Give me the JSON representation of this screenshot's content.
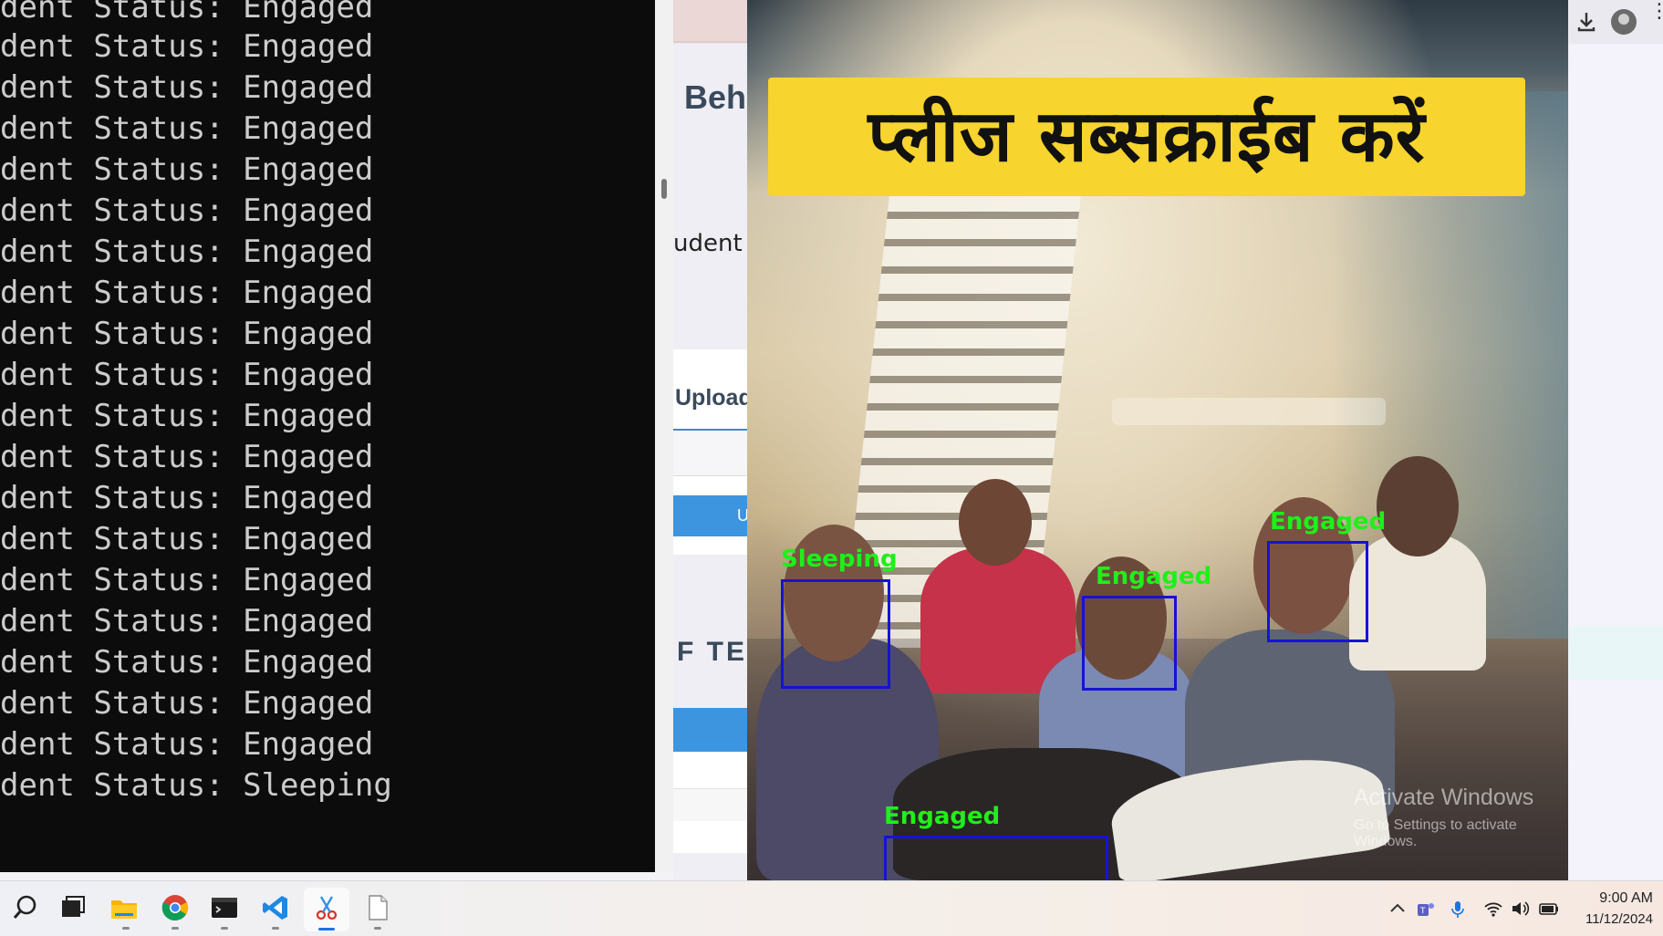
{
  "terminal": {
    "lines": [
      "dent Status: Engaged",
      "dent Status: Engaged",
      "dent Status: Engaged",
      "dent Status: Engaged",
      "dent Status: Engaged",
      "dent Status: Engaged",
      "dent Status: Engaged",
      "dent Status: Engaged",
      "dent Status: Engaged",
      "dent Status: Engaged",
      "dent Status: Engaged",
      "dent Status: Engaged",
      "dent Status: Engaged",
      "dent Status: Engaged",
      "dent Status: Engaged",
      "dent Status: Engaged",
      "dent Status: Engaged",
      "dent Status: Engaged",
      "dent Status: Engaged",
      "dent Status: Sleeping"
    ]
  },
  "browser": {
    "page_title": "Beh",
    "student_label": "udent",
    "upload_label": "Upload",
    "upload_button_label": "U",
    "tech_heading": "F TEC",
    "icons": {
      "download": "download-icon",
      "profile": "profile-icon",
      "menu": "more-vert-icon"
    }
  },
  "video": {
    "banner_text": "प्लीज सब्सक्राईब करें",
    "detections": [
      {
        "label": "Sleeping"
      },
      {
        "label": "Engaged"
      },
      {
        "label": "Engaged"
      },
      {
        "label": "Engaged"
      }
    ],
    "box_color": "#1612d6",
    "label_color": "#1ef01a",
    "watermark_title": "Activate Windows",
    "watermark_sub": "Go to Settings to activate Windows."
  },
  "taskbar": {
    "apps": [
      "search-icon",
      "task-view-icon",
      "file-explorer-icon",
      "chrome-icon",
      "terminal-icon",
      "vscode-icon",
      "snipping-tool-icon",
      "notepad-icon"
    ],
    "active_app": "snipping-tool-icon",
    "tray": [
      "chevron-up-icon",
      "teams-icon",
      "microphone-icon",
      "wifi-icon",
      "volume-icon",
      "battery-icon"
    ],
    "time": "9:00 AM",
    "date": "11/12/2024"
  }
}
